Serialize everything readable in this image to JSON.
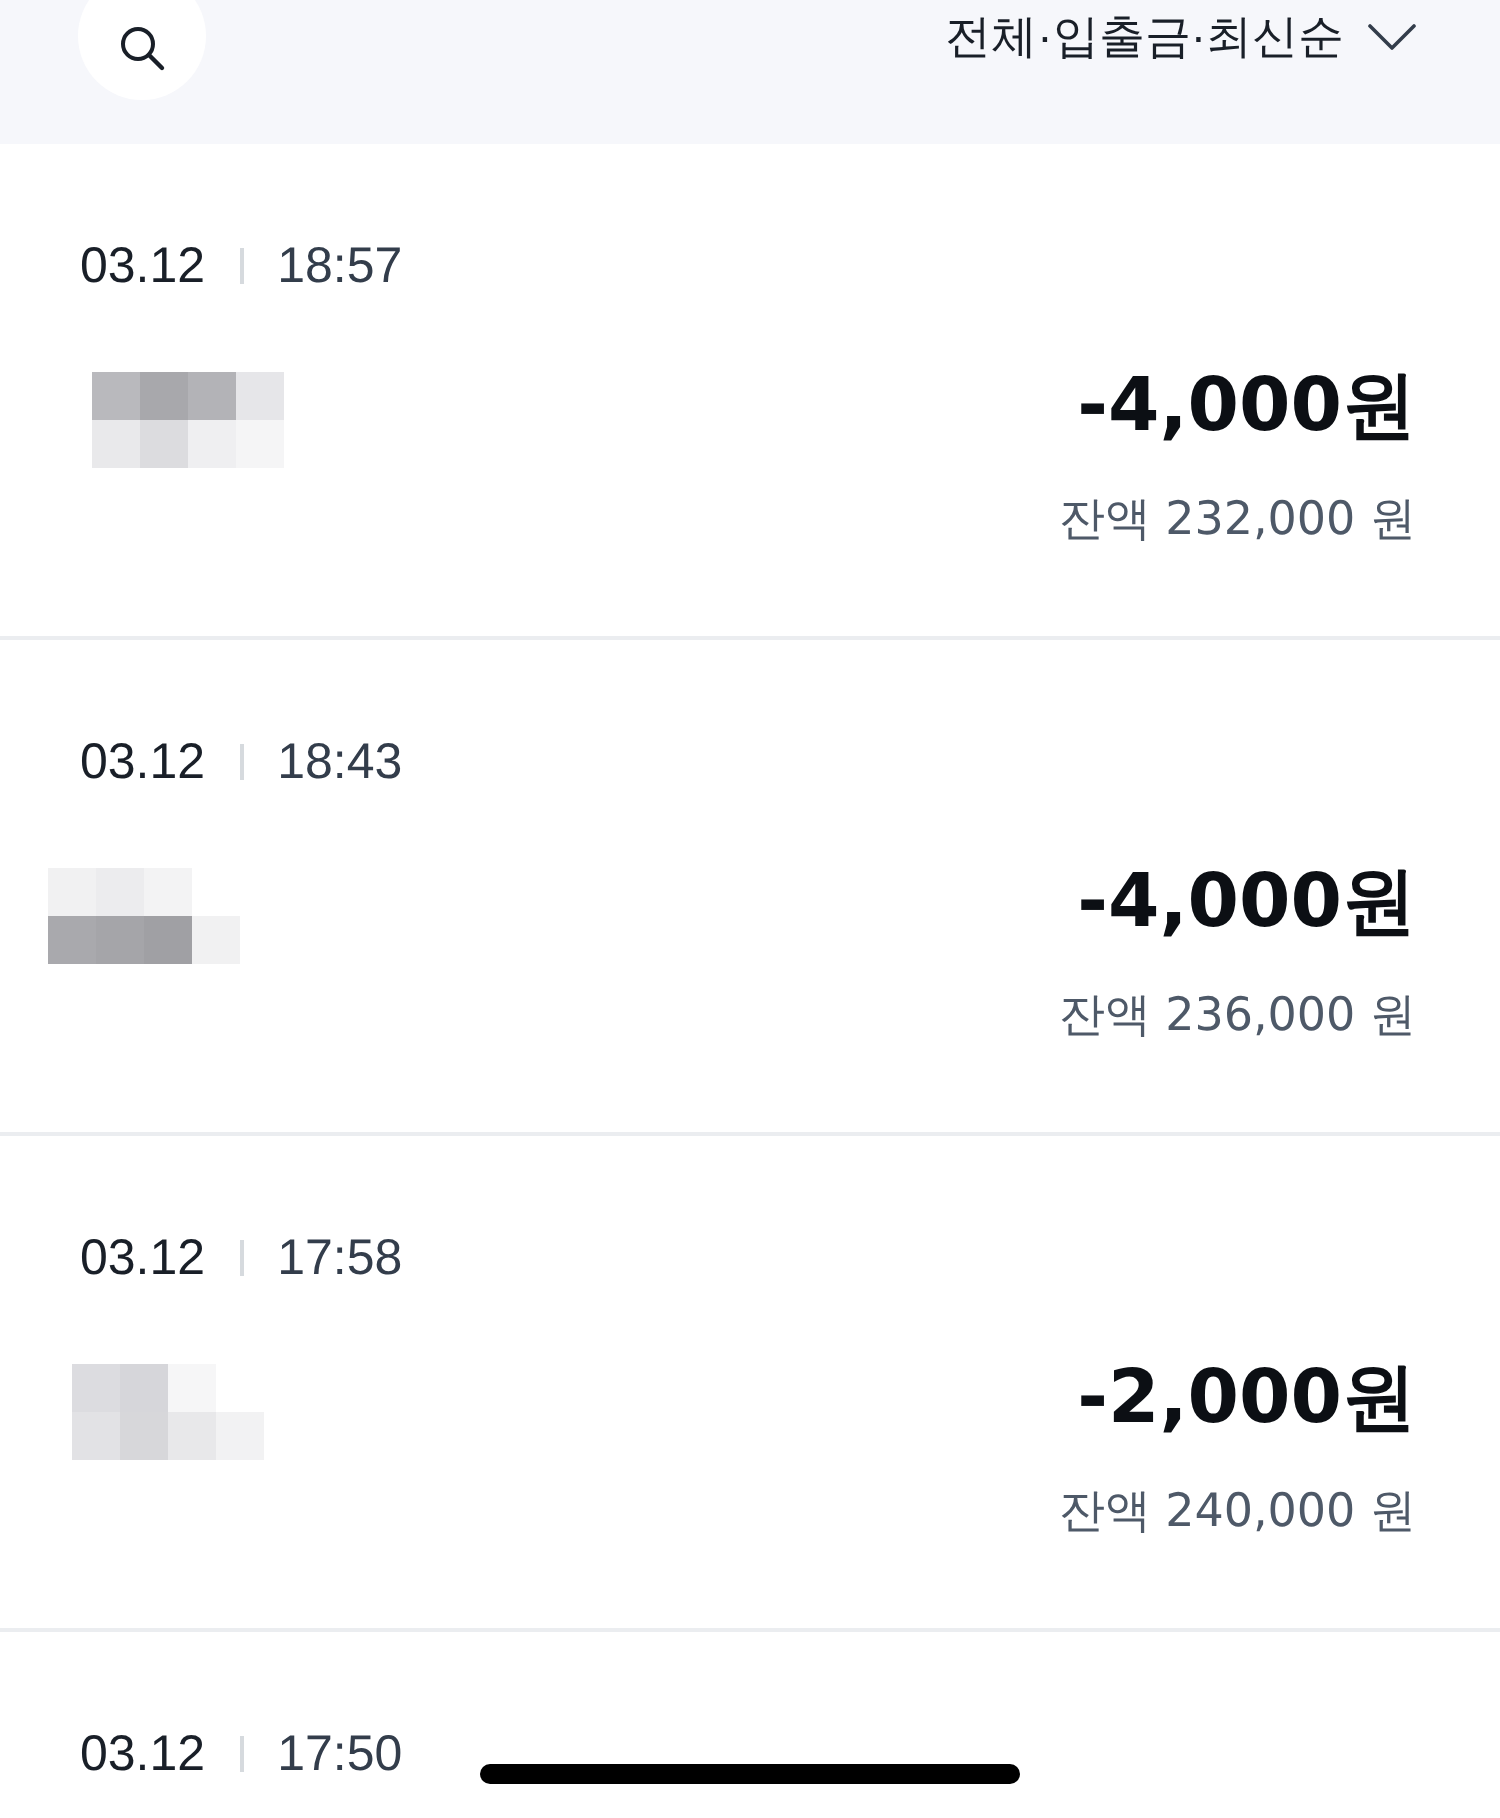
{
  "header": {
    "filter_label": "전체·입출금·최신순"
  },
  "transactions": [
    {
      "date": "03.12",
      "time": "18:57",
      "amount": "-4,000원",
      "balance": "잔액 232,000 원"
    },
    {
      "date": "03.12",
      "time": "18:43",
      "amount": "-4,000원",
      "balance": "잔액 236,000 원"
    },
    {
      "date": "03.12",
      "time": "17:58",
      "amount": "-2,000원",
      "balance": "잔액 240,000 원"
    },
    {
      "date": "03.12",
      "time": "17:50"
    }
  ]
}
